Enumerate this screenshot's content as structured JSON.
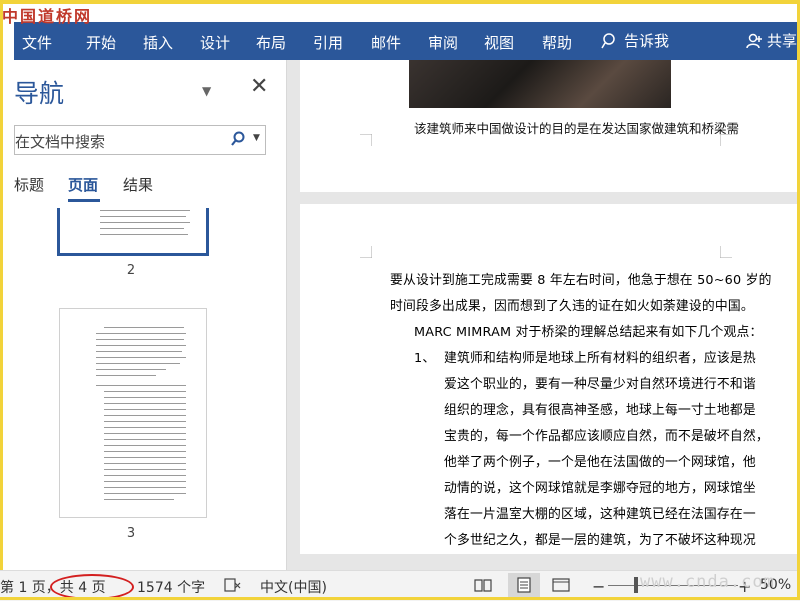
{
  "watermark_top": "中国道桥网",
  "ribbon": {
    "tabs": [
      "文件",
      "开始",
      "插入",
      "设计",
      "布局",
      "引用",
      "邮件",
      "审阅",
      "视图",
      "帮助"
    ],
    "tell_me": "告诉我",
    "share": "共享"
  },
  "nav": {
    "title": "导航",
    "search_placeholder": "在文档中搜索",
    "tabs": [
      "标题",
      "页面",
      "结果"
    ],
    "active_tab": "页面",
    "thumbnails": [
      {
        "label": "2"
      },
      {
        "label": "3"
      }
    ]
  },
  "document": {
    "caption": "该建筑师来中国做设计的目的是在发达国家做建筑和桥梁需",
    "lines": [
      "要从设计到施工完成需要 8 年左右时间，他急于想在 50~60 岁的",
      "时间段多出成果，因而想到了久违的证在如火如荼建设的中国。",
      "MARC MIMRAM 对于桥梁的理解总结起来有如下几个观点：",
      "1、",
      "建筑师和结构师是地球上所有材料的组织者，应该是热",
      "爱这个职业的，要有一种尽量少对自然环境进行不和谐",
      "组织的理念，具有很高神圣感，地球上每一寸土地都是",
      "宝贵的，每一个作品都应该顺应自然，而不是破坏自然，",
      "他举了两个例子，一个是他在法国做的一个网球馆，他",
      "动情的说，这个网球馆就是李娜夺冠的地方，网球馆坐",
      "落在一片温室大棚的区域，这种建筑已经在法国存在一",
      "个多世纪之久，都是一层的建筑，为了不破坏这种现况"
    ]
  },
  "status": {
    "page": "第 1 页，共 4 页",
    "words": "1574 个字",
    "language": "中文(中国)",
    "zoom": "50%",
    "watermark": "www.cnda.com"
  }
}
